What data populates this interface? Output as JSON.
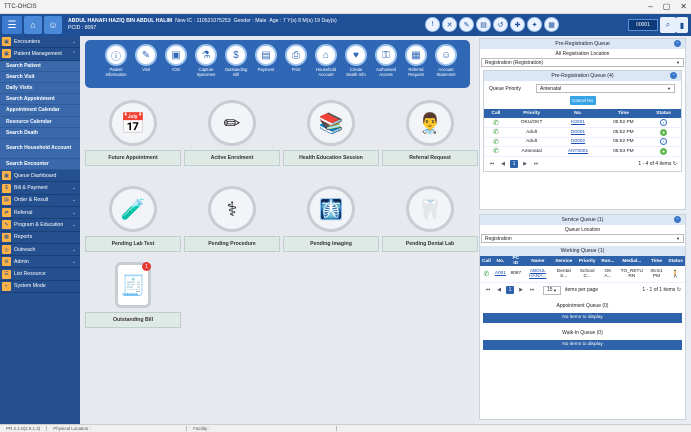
{
  "window": {
    "title": "TTC-OHCIS"
  },
  "patient": {
    "name": "ABDUL HANAFI HAZIQ BIN ABDUL HALIM",
    "new_ic": "New IC : 110521075253",
    "gender": "Gender : Male",
    "age": "Age : 7 Y(s) 8 M(s) 19 Day(s)",
    "pcid": "PCID : 8097"
  },
  "appbar": {
    "code": "00001"
  },
  "sidebar": {
    "items": [
      {
        "label": "Encounters",
        "has_chevron": true
      },
      {
        "label": "Patient Management",
        "has_chevron": true
      }
    ],
    "subitems": [
      "Search Patient",
      "Search Visit",
      "Daily Visits",
      "Search Appointment",
      "Appointment Calendar",
      "Resource Calendar",
      "Search Death",
      "Search Household Account",
      "Search Encounter"
    ],
    "lower_items": [
      {
        "label": "Queue Dashboard",
        "has_chevron": false
      },
      {
        "label": "Bill & Payment",
        "has_chevron": true
      },
      {
        "label": "Order & Result",
        "has_chevron": true
      },
      {
        "label": "Referral",
        "has_chevron": true
      },
      {
        "label": "Program & Education",
        "has_chevron": true
      },
      {
        "label": "Reports",
        "has_chevron": false
      },
      {
        "label": "Outreach",
        "has_chevron": true
      },
      {
        "label": "Admin",
        "has_chevron": true
      },
      {
        "label": "List Resource",
        "has_chevron": false
      },
      {
        "label": "System Mode",
        "has_chevron": false
      }
    ]
  },
  "ribbon": [
    {
      "label": "Patient\nInformation",
      "icon": "person-info-icon"
    },
    {
      "label": "Visit",
      "icon": "visit-icon"
    },
    {
      "label": "ICM",
      "icon": "icm-icon"
    },
    {
      "label": "Capture\nSpecimen",
      "icon": "specimen-icon"
    },
    {
      "label": "Outstanding\nBill",
      "icon": "bill-icon"
    },
    {
      "label": "Payment",
      "icon": "payment-icon"
    },
    {
      "label": "Print",
      "icon": "print-icon"
    },
    {
      "label": "Household\nAccount",
      "icon": "household-icon"
    },
    {
      "label": "Create\nDeath Info",
      "icon": "death-info-icon"
    },
    {
      "label": "Authorised\nAccess",
      "icon": "authorised-icon"
    },
    {
      "label": "Referral\nRequest",
      "icon": "referral-icon"
    },
    {
      "label": "Account\nStatement",
      "icon": "statement-icon"
    }
  ],
  "tiles": [
    {
      "label": "Future Appointment",
      "icon": "calendar-icon",
      "glyph": "📅"
    },
    {
      "label": "Active Enrolment",
      "icon": "enrolment-icon",
      "glyph": "✏"
    },
    {
      "label": "Health Education Session",
      "icon": "education-icon",
      "glyph": "📚"
    },
    {
      "label": "Referral Request",
      "icon": "doctor-icon",
      "glyph": "👨‍⚕"
    },
    {
      "label": "Pending Lab Test",
      "icon": "lab-icon",
      "glyph": "🧪"
    },
    {
      "label": "Pending Procedure",
      "icon": "procedure-icon",
      "glyph": "⚕"
    },
    {
      "label": "Pending Imaging",
      "icon": "imaging-icon",
      "glyph": "🩻"
    },
    {
      "label": "Pending Dental Lab",
      "icon": "dental-icon",
      "glyph": "🦷"
    },
    {
      "label": "Outstanding Bill",
      "icon": "invoice-icon",
      "glyph": "🧾",
      "badge": "1"
    }
  ],
  "prereg": {
    "title": "Pre-Registration Queue",
    "location_label": "All Registration Location",
    "location_value": "Registration (Registration)",
    "inner_title": "Pre-Registration Queue (4)",
    "priority_label": "Queue Priority",
    "priority_value": "Antenatal",
    "cancel_label": "Cancel No",
    "columns": [
      "Call",
      "Priority",
      "No.",
      "Time",
      "Status"
    ],
    "rows": [
      {
        "priority": "OKU/OKT",
        "no": "K0001",
        "time": "05:52 PM",
        "status": "i"
      },
      {
        "priority": "Adult",
        "no": "D0001",
        "time": "05:52 PM",
        "status": "g"
      },
      {
        "priority": "Adult",
        "no": "D0002",
        "time": "05:52 PM",
        "status": "i"
      },
      {
        "priority": "Antenatal",
        "no": "ANT0001",
        "time": "05:53 PM",
        "status": "g"
      }
    ],
    "page": "1",
    "summary": "1 - 4 of 4 items"
  },
  "service": {
    "title": "Service Queue (1)",
    "location_label": "Queue Location",
    "location_value": "Registration",
    "working_title": "Working Queue (1)",
    "columns": [
      "Call",
      "No.",
      "PC ID",
      "Name",
      "Service",
      "Priority",
      "Rsn...",
      "Medial...",
      "Time",
      "Status"
    ],
    "rows": [
      {
        "no": "A001",
        "pcid": "8097",
        "name": "ABDUL HANA...",
        "service": "Dental S...",
        "priority": "School C...",
        "rsn": "OK A...",
        "medial": "TO_RETU RN",
        "time": "05:51 PM"
      }
    ],
    "page": "1",
    "per_page": "15",
    "per_page_label": "items per page",
    "summary": "1 - 1 of 1 items",
    "appointment_title": "Appointment Queue (0)",
    "appointment_empty": "No items to display",
    "walkin_title": "Walk-In Queue (0)",
    "walkin_empty": "No items to display"
  },
  "statusbar": {
    "left": "PR 2.1.0(2.0.1.3)",
    "location": "Physical Location :",
    "facility": "Facility :"
  }
}
